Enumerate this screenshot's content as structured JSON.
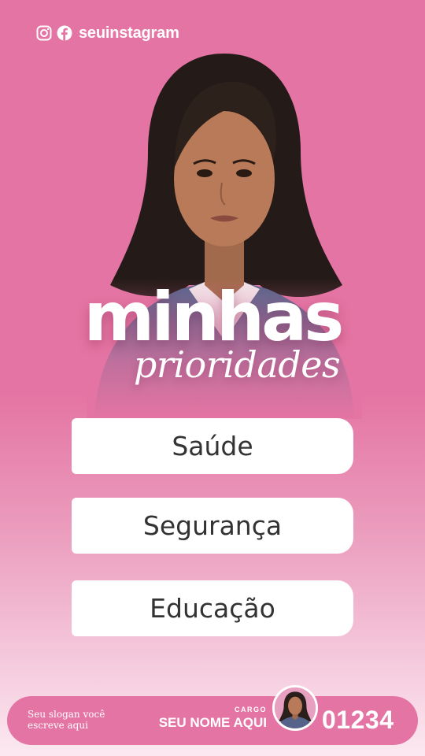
{
  "social": {
    "icons": [
      "instagram-icon",
      "facebook-icon"
    ],
    "handle": "seuinstagram"
  },
  "headline": {
    "main": "minhas",
    "script": "prioridades"
  },
  "priorities": [
    {
      "label": "Saúde"
    },
    {
      "label": "Segurança"
    },
    {
      "label": "Educação"
    }
  ],
  "footer": {
    "slogan": "Seu slogan você escreve aqui",
    "cargo": "CARGO",
    "name": "SEU NOME AQUI",
    "number": "01234"
  },
  "colors": {
    "background": "#e474a3",
    "card": "#ffffff",
    "card_text": "#333333",
    "text_light": "#ffffff"
  }
}
